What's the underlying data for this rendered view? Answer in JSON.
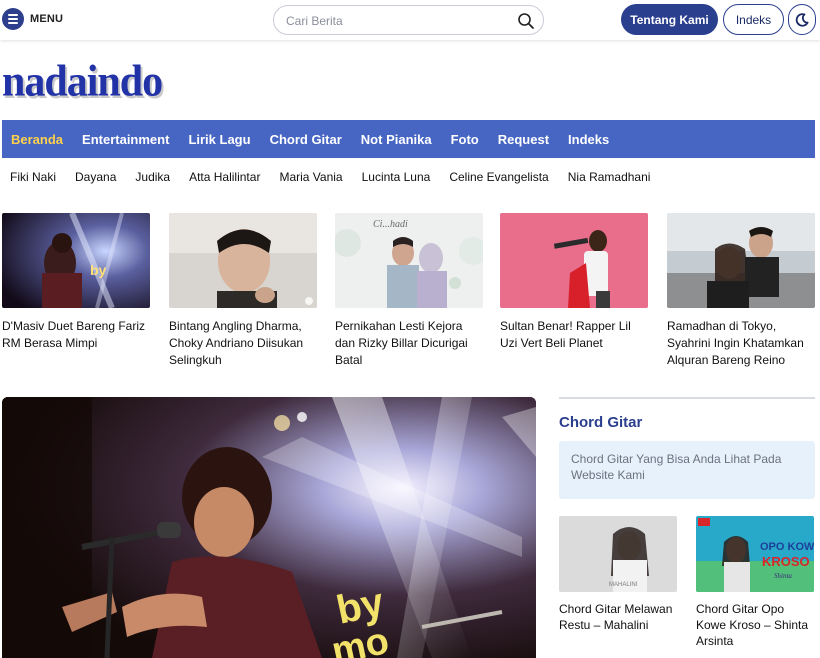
{
  "topbar": {
    "menu_label": "MENU",
    "search_placeholder": "Cari Berita",
    "about_label": "Tentang Kami",
    "index_label": "Indeks"
  },
  "logo": {
    "text": "nadaindo"
  },
  "main_nav": [
    {
      "label": "Beranda",
      "active": true
    },
    {
      "label": "Entertainment"
    },
    {
      "label": "Lirik Lagu"
    },
    {
      "label": "Chord Gitar"
    },
    {
      "label": "Not Pianika"
    },
    {
      "label": "Foto"
    },
    {
      "label": "Request"
    },
    {
      "label": "Indeks"
    }
  ],
  "sub_nav": [
    {
      "label": "Fiki Naki"
    },
    {
      "label": "Dayana"
    },
    {
      "label": "Judika"
    },
    {
      "label": "Atta Halilintar"
    },
    {
      "label": "Maria Vania"
    },
    {
      "label": "Lucinta Luna"
    },
    {
      "label": "Celine Evangelista"
    },
    {
      "label": "Nia Ramadhani"
    }
  ],
  "cards": [
    {
      "title": "D'Masiv Duet Bareng Fariz RM Berasa Mimpi"
    },
    {
      "title": "Bintang Angling Dharma, Choky Andriano Diisukan Selingkuh"
    },
    {
      "title": "Pernikahan Lesti Kejora dan Rizky Billar Dicurigai Batal"
    },
    {
      "title": "Sultan Benar! Rapper Lil Uzi Vert Beli Planet"
    },
    {
      "title": "Ramadhan di Tokyo, Syahrini Ingin Khatamkan Alquran Bareng Reino"
    }
  ],
  "sidebar": {
    "title": "Chord Gitar",
    "description": "Chord Gitar Yang Bisa Anda Lihat Pada Website Kami",
    "items": [
      {
        "title": "Chord Gitar Melawan Restu – Mahalini"
      },
      {
        "title": "Chord Gitar Opo Kowe Kroso – Shinta Arsinta"
      }
    ]
  },
  "colors": {
    "brand": "#2b3f8f",
    "nav_bg": "#4766c4",
    "nav_active": "#ffd24a",
    "side_box_bg": "#e6f1fb"
  },
  "icons": {
    "menu": "hamburger-icon",
    "search": "search-icon",
    "dark_mode": "moon-icon"
  }
}
